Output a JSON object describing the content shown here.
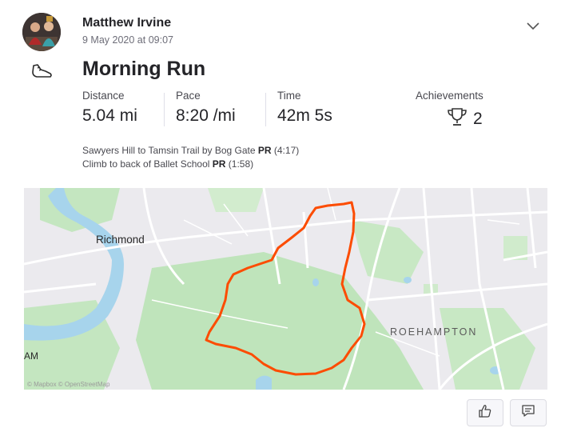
{
  "athlete": {
    "name": "Matthew Irvine",
    "timestamp": "9 May 2020 at 09:07"
  },
  "activity": {
    "type_icon": "shoe-icon",
    "title": "Morning Run"
  },
  "stats": [
    {
      "label": "Distance",
      "value": "5.04 mi"
    },
    {
      "label": "Pace",
      "value": "8:20 /mi"
    },
    {
      "label": "Time",
      "value": "42m 5s"
    }
  ],
  "achievements": {
    "label": "Achievements",
    "icon": "trophy-icon",
    "count": "2"
  },
  "segments": [
    {
      "name": "Sawyers Hill to Tamsin Trail by Bog Gate",
      "badge": "PR",
      "time": "(4:17)"
    },
    {
      "name": "Climb to back of Ballet School",
      "badge": "PR",
      "time": "(1:58)"
    }
  ],
  "map": {
    "labels": {
      "richmond": "Richmond",
      "roehampton": "ROEHAMPTON",
      "edge": "AM"
    },
    "attribution": "© Mapbox © OpenStreetMap",
    "route_color": "#fc4c02"
  },
  "actions": {
    "kudos_icon": "thumbs-up-icon",
    "comment_icon": "comment-icon"
  }
}
